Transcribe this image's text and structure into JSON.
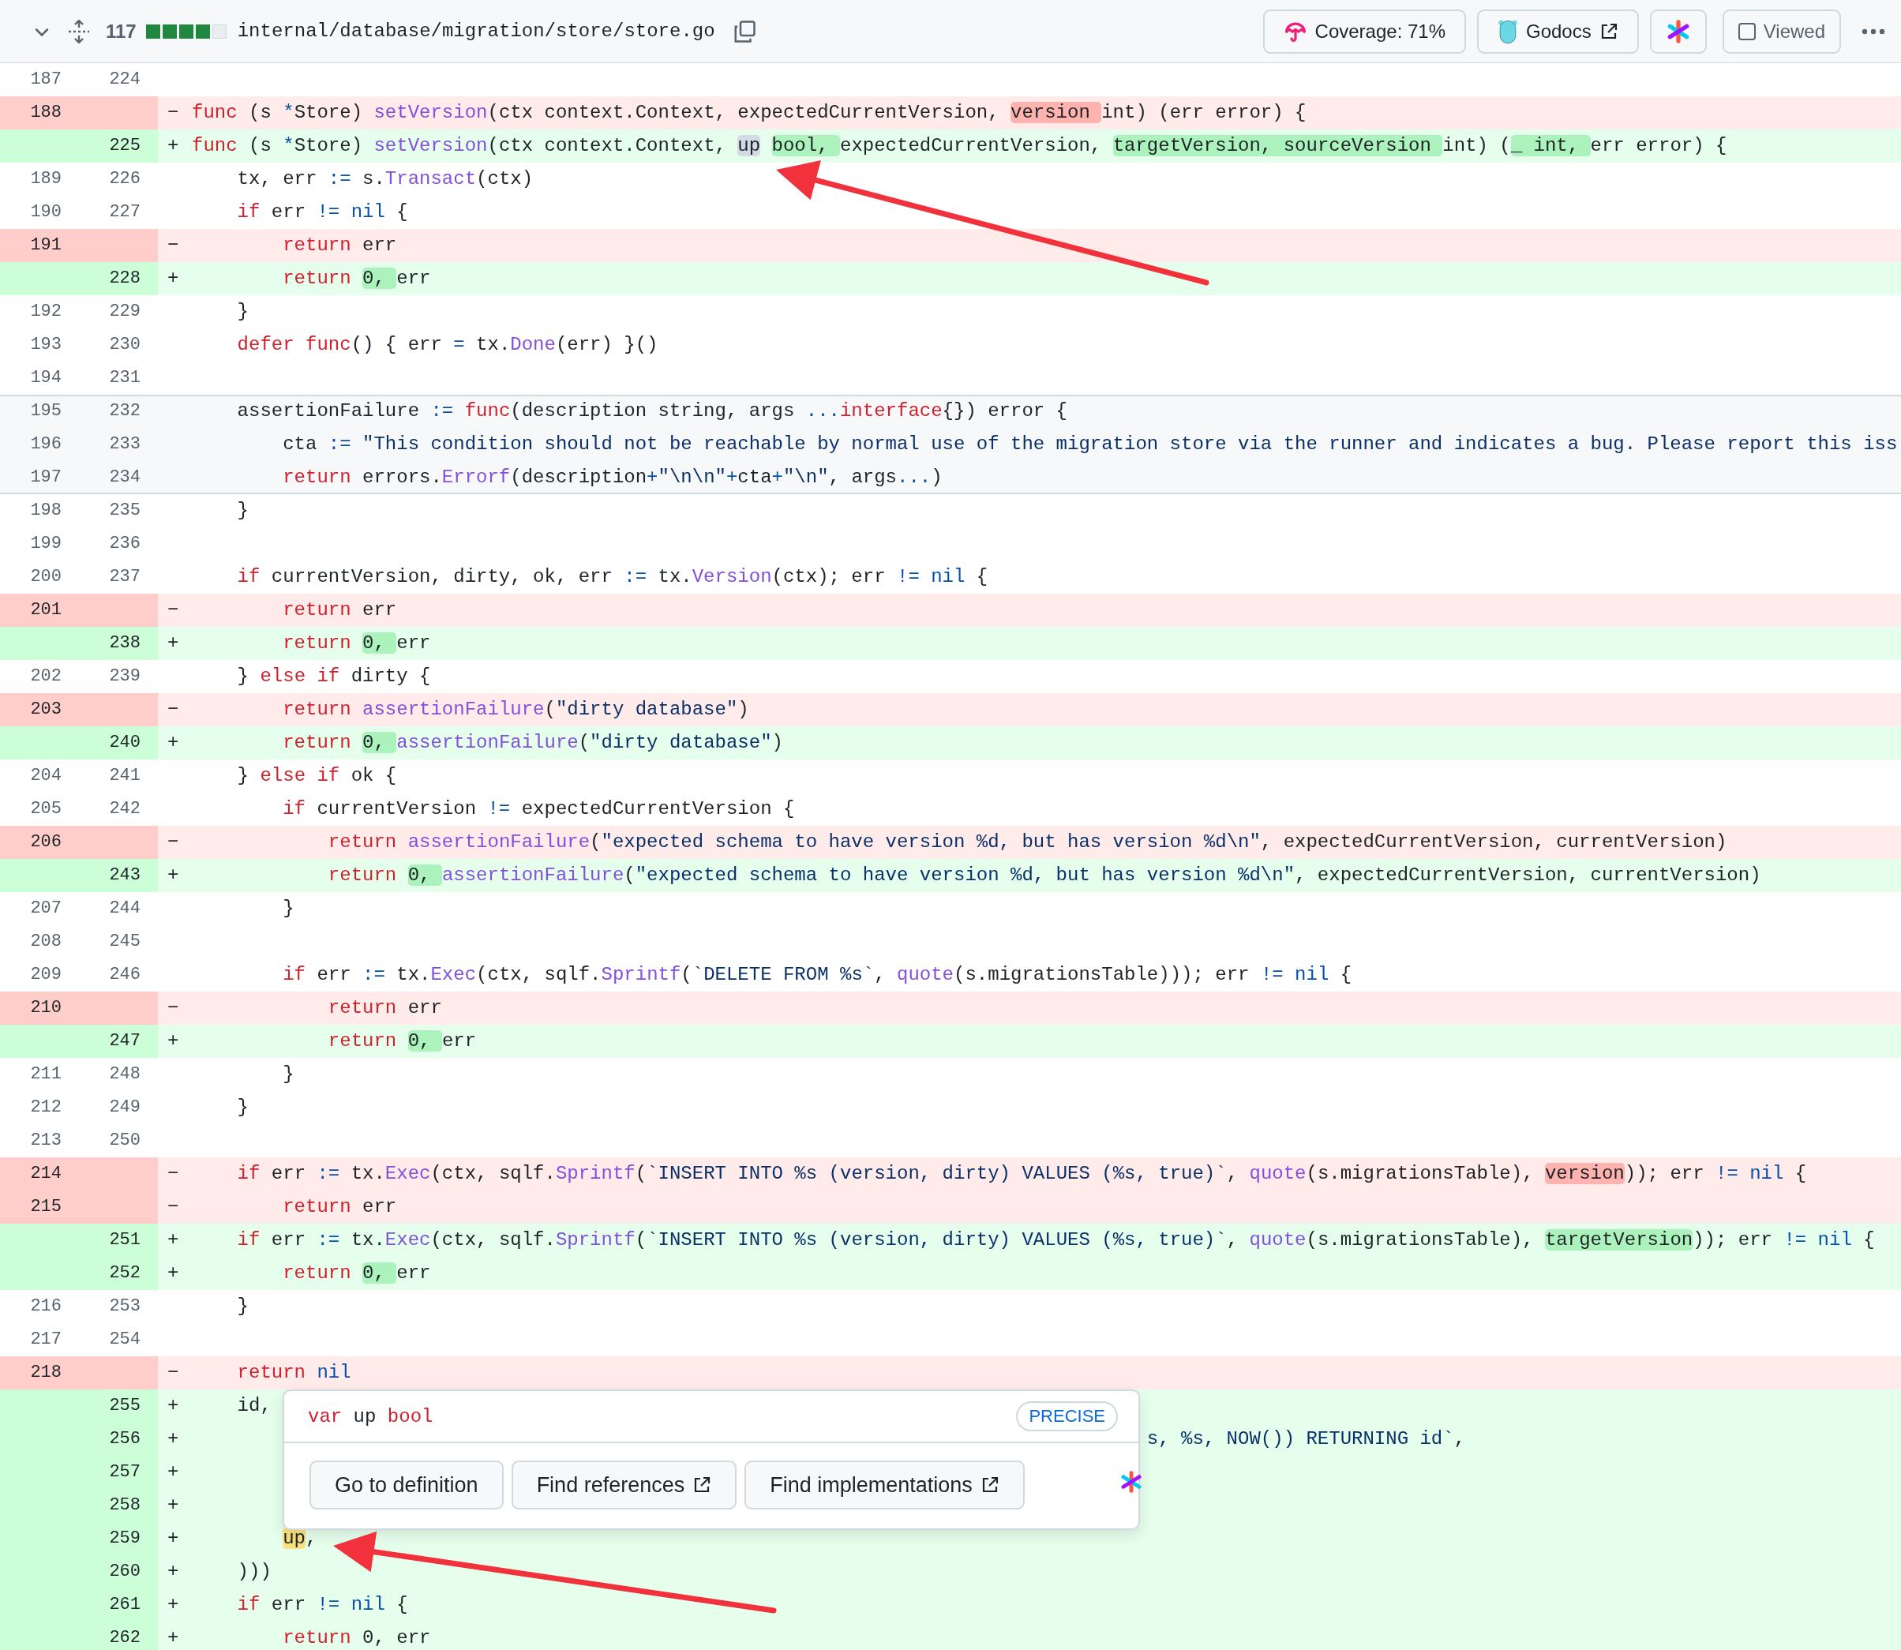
{
  "file_header": {
    "expanded": true,
    "changes": "117",
    "diffstat": [
      {
        "kind": "added"
      },
      {
        "kind": "added"
      },
      {
        "kind": "added"
      },
      {
        "kind": "added"
      },
      {
        "kind": "neutral"
      }
    ],
    "path": "internal/database/migration/store/store.go",
    "buttons": [
      {
        "kind": "coverage",
        "label": "Coverage: 71%"
      },
      {
        "kind": "godocs",
        "label": "Godocs",
        "external": true
      },
      {
        "kind": "extension"
      }
    ],
    "viewed": {
      "label": "Viewed",
      "checked": false
    }
  },
  "lines": [
    {
      "kind": "context",
      "old": "187",
      "new": "224"
    },
    {
      "kind": "deleted",
      "old": "188",
      "sign": "−",
      "code": [
        {
          "text": "func",
          "kind": "keyword"
        },
        {
          "text": " (s ",
          "kind": "plain"
        },
        {
          "text": "*",
          "kind": "operator"
        },
        {
          "text": "Store) ",
          "kind": "plain"
        },
        {
          "text": "setVersion",
          "kind": "function"
        },
        {
          "text": "(ctx context.Context, expectedCurrentVersion, ",
          "kind": "plain"
        },
        {
          "text": "version ",
          "kind": "plain",
          "changed": true
        },
        {
          "text": "int) (err error) {",
          "kind": "plain"
        }
      ]
    },
    {
      "kind": "added",
      "new": "225",
      "sign": "+",
      "code": [
        {
          "text": "func",
          "kind": "keyword"
        },
        {
          "text": " (s ",
          "kind": "plain"
        },
        {
          "text": "*",
          "kind": "operator"
        },
        {
          "text": "Store) ",
          "kind": "plain"
        },
        {
          "text": "setVersion",
          "kind": "function"
        },
        {
          "text": "(ctx context.Context, ",
          "kind": "plain"
        },
        {
          "text": "up",
          "kind": "reference"
        },
        {
          "text": " bool, ",
          "kind": "plain",
          "changed": true
        },
        {
          "text": "expectedCurrentVersion, ",
          "kind": "plain"
        },
        {
          "text": "targetVersion, sourceVersion ",
          "kind": "plain",
          "changed": true
        },
        {
          "text": "int) (",
          "kind": "plain"
        },
        {
          "text": "_ int, ",
          "kind": "plain",
          "changed": true
        },
        {
          "text": "err error) {",
          "kind": "plain"
        }
      ]
    },
    {
      "kind": "context",
      "old": "189",
      "new": "226",
      "code": [
        {
          "text": "    tx, err ",
          "kind": "plain"
        },
        {
          "text": ":=",
          "kind": "operator"
        },
        {
          "text": " s.",
          "kind": "plain"
        },
        {
          "text": "Transact",
          "kind": "function"
        },
        {
          "text": "(ctx)",
          "kind": "plain"
        }
      ]
    },
    {
      "kind": "context",
      "old": "190",
      "new": "227",
      "code": [
        {
          "text": "    if",
          "kind": "keyword"
        },
        {
          "text": " err ",
          "kind": "plain"
        },
        {
          "text": "!=",
          "kind": "operator"
        },
        {
          "text": " nil",
          "kind": "constant"
        },
        {
          "text": " {",
          "kind": "plain"
        }
      ]
    },
    {
      "kind": "deleted",
      "old": "191",
      "sign": "−",
      "code": [
        {
          "text": "        return",
          "kind": "keyword"
        },
        {
          "text": " err",
          "kind": "plain"
        }
      ]
    },
    {
      "kind": "added",
      "new": "228",
      "sign": "+",
      "code": [
        {
          "text": "        return ",
          "kind": "keyword"
        },
        {
          "text": "0, ",
          "kind": "plain",
          "changed": true
        },
        {
          "text": "err",
          "kind": "plain"
        }
      ]
    },
    {
      "kind": "context",
      "old": "192",
      "new": "229",
      "code": [
        {
          "text": "    }",
          "kind": "plain"
        }
      ]
    },
    {
      "kind": "context",
      "old": "193",
      "new": "230",
      "code": [
        {
          "text": "    defer",
          "kind": "keyword"
        },
        {
          "text": " func",
          "kind": "keyword"
        },
        {
          "text": "() { err ",
          "kind": "plain"
        },
        {
          "text": "=",
          "kind": "operator"
        },
        {
          "text": " tx.",
          "kind": "plain"
        },
        {
          "text": "Done",
          "kind": "function"
        },
        {
          "text": "(err) }()",
          "kind": "plain"
        }
      ]
    },
    {
      "kind": "context",
      "old": "194",
      "new": "231"
    },
    {
      "kind": "expanded",
      "old": "195",
      "new": "232",
      "code": [
        {
          "text": "    assertionFailure ",
          "kind": "plain"
        },
        {
          "text": ":=",
          "kind": "operator"
        },
        {
          "text": " func",
          "kind": "keyword"
        },
        {
          "text": "(description string, args ",
          "kind": "plain"
        },
        {
          "text": "...",
          "kind": "operator"
        },
        {
          "text": "interface",
          "kind": "keyword"
        },
        {
          "text": "{}) error {",
          "kind": "plain"
        }
      ]
    },
    {
      "kind": "expanded",
      "old": "196",
      "new": "233",
      "code": [
        {
          "text": "        cta ",
          "kind": "plain"
        },
        {
          "text": ":=",
          "kind": "operator"
        },
        {
          "text": " \"This condition should not be reachable by normal use of the migration store via the runner and indicates a bug. Please report this iss",
          "kind": "string"
        }
      ]
    },
    {
      "kind": "expanded",
      "old": "197",
      "new": "234",
      "code": [
        {
          "text": "        return",
          "kind": "keyword"
        },
        {
          "text": " errors.",
          "kind": "plain"
        },
        {
          "text": "Errorf",
          "kind": "function"
        },
        {
          "text": "(description",
          "kind": "plain"
        },
        {
          "text": "+",
          "kind": "operator"
        },
        {
          "text": "\"\\n\\n\"",
          "kind": "string"
        },
        {
          "text": "+",
          "kind": "operator"
        },
        {
          "text": "cta",
          "kind": "plain"
        },
        {
          "text": "+",
          "kind": "operator"
        },
        {
          "text": "\"\\n\"",
          "kind": "string"
        },
        {
          "text": ", args",
          "kind": "plain"
        },
        {
          "text": "...",
          "kind": "operator"
        },
        {
          "text": ")",
          "kind": "plain"
        }
      ]
    },
    {
      "kind": "context",
      "old": "198",
      "new": "235",
      "code": [
        {
          "text": "    }",
          "kind": "plain"
        }
      ]
    },
    {
      "kind": "context",
      "old": "199",
      "new": "236"
    },
    {
      "kind": "context",
      "old": "200",
      "new": "237",
      "code": [
        {
          "text": "    if",
          "kind": "keyword"
        },
        {
          "text": " currentVersion, dirty, ok, err ",
          "kind": "plain"
        },
        {
          "text": ":=",
          "kind": "operator"
        },
        {
          "text": " tx.",
          "kind": "plain"
        },
        {
          "text": "Version",
          "kind": "function"
        },
        {
          "text": "(ctx); err ",
          "kind": "plain"
        },
        {
          "text": "!=",
          "kind": "operator"
        },
        {
          "text": " nil",
          "kind": "constant"
        },
        {
          "text": " {",
          "kind": "plain"
        }
      ]
    },
    {
      "kind": "deleted",
      "old": "201",
      "sign": "−",
      "code": [
        {
          "text": "        return",
          "kind": "keyword"
        },
        {
          "text": " err",
          "kind": "plain"
        }
      ]
    },
    {
      "kind": "added",
      "new": "238",
      "sign": "+",
      "code": [
        {
          "text": "        return ",
          "kind": "keyword"
        },
        {
          "text": "0, ",
          "kind": "plain",
          "changed": true
        },
        {
          "text": "err",
          "kind": "plain"
        }
      ]
    },
    {
      "kind": "context",
      "old": "202",
      "new": "239",
      "code": [
        {
          "text": "    } ",
          "kind": "plain"
        },
        {
          "text": "else",
          "kind": "keyword"
        },
        {
          "text": " if",
          "kind": "keyword"
        },
        {
          "text": " dirty {",
          "kind": "plain"
        }
      ]
    },
    {
      "kind": "deleted",
      "old": "203",
      "sign": "−",
      "code": [
        {
          "text": "        return ",
          "kind": "keyword"
        },
        {
          "text": "assertionFailure",
          "kind": "function"
        },
        {
          "text": "(",
          "kind": "plain"
        },
        {
          "text": "\"dirty database\"",
          "kind": "string"
        },
        {
          "text": ")",
          "kind": "plain"
        }
      ]
    },
    {
      "kind": "added",
      "new": "240",
      "sign": "+",
      "code": [
        {
          "text": "        return ",
          "kind": "keyword"
        },
        {
          "text": "0, ",
          "kind": "plain",
          "changed": true
        },
        {
          "text": "assertionFailure",
          "kind": "function"
        },
        {
          "text": "(",
          "kind": "plain"
        },
        {
          "text": "\"dirty database\"",
          "kind": "string"
        },
        {
          "text": ")",
          "kind": "plain"
        }
      ]
    },
    {
      "kind": "context",
      "old": "204",
      "new": "241",
      "code": [
        {
          "text": "    } ",
          "kind": "plain"
        },
        {
          "text": "else",
          "kind": "keyword"
        },
        {
          "text": " if",
          "kind": "keyword"
        },
        {
          "text": " ok {",
          "kind": "plain"
        }
      ]
    },
    {
      "kind": "context",
      "old": "205",
      "new": "242",
      "code": [
        {
          "text": "        if",
          "kind": "keyword"
        },
        {
          "text": " currentVersion ",
          "kind": "plain"
        },
        {
          "text": "!=",
          "kind": "operator"
        },
        {
          "text": " expectedCurrentVersion {",
          "kind": "plain"
        }
      ]
    },
    {
      "kind": "deleted",
      "old": "206",
      "sign": "−",
      "code": [
        {
          "text": "            return ",
          "kind": "keyword"
        },
        {
          "text": "assertionFailure",
          "kind": "function"
        },
        {
          "text": "(",
          "kind": "plain"
        },
        {
          "text": "\"expected schema to have version %d, but has version %d\\n\"",
          "kind": "string"
        },
        {
          "text": ", expectedCurrentVersion, currentVersion)",
          "kind": "plain"
        }
      ]
    },
    {
      "kind": "added",
      "new": "243",
      "sign": "+",
      "code": [
        {
          "text": "            return ",
          "kind": "keyword"
        },
        {
          "text": "0, ",
          "kind": "plain",
          "changed": true
        },
        {
          "text": "assertionFailure",
          "kind": "function"
        },
        {
          "text": "(",
          "kind": "plain"
        },
        {
          "text": "\"expected schema to have version %d, but has version %d\\n\"",
          "kind": "string"
        },
        {
          "text": ", expectedCurrentVersion, currentVersion)",
          "kind": "plain"
        }
      ]
    },
    {
      "kind": "context",
      "old": "207",
      "new": "244",
      "code": [
        {
          "text": "        }",
          "kind": "plain"
        }
      ]
    },
    {
      "kind": "context",
      "old": "208",
      "new": "245"
    },
    {
      "kind": "context",
      "old": "209",
      "new": "246",
      "code": [
        {
          "text": "        if",
          "kind": "keyword"
        },
        {
          "text": " err ",
          "kind": "plain"
        },
        {
          "text": ":=",
          "kind": "operator"
        },
        {
          "text": " tx.",
          "kind": "plain"
        },
        {
          "text": "Exec",
          "kind": "function"
        },
        {
          "text": "(ctx, sqlf.",
          "kind": "plain"
        },
        {
          "text": "Sprintf",
          "kind": "function"
        },
        {
          "text": "(",
          "kind": "plain"
        },
        {
          "text": "`DELETE FROM %s`",
          "kind": "string"
        },
        {
          "text": ", ",
          "kind": "plain"
        },
        {
          "text": "quote",
          "kind": "function"
        },
        {
          "text": "(s.migrationsTable))); err ",
          "kind": "plain"
        },
        {
          "text": "!=",
          "kind": "operator"
        },
        {
          "text": " nil",
          "kind": "constant"
        },
        {
          "text": " {",
          "kind": "plain"
        }
      ]
    },
    {
      "kind": "deleted",
      "old": "210",
      "sign": "−",
      "code": [
        {
          "text": "            return",
          "kind": "keyword"
        },
        {
          "text": " err",
          "kind": "plain"
        }
      ]
    },
    {
      "kind": "added",
      "new": "247",
      "sign": "+",
      "code": [
        {
          "text": "            return ",
          "kind": "keyword"
        },
        {
          "text": "0, ",
          "kind": "plain",
          "changed": true
        },
        {
          "text": "err",
          "kind": "plain"
        }
      ]
    },
    {
      "kind": "context",
      "old": "211",
      "new": "248",
      "code": [
        {
          "text": "        }",
          "kind": "plain"
        }
      ]
    },
    {
      "kind": "context",
      "old": "212",
      "new": "249",
      "code": [
        {
          "text": "    }",
          "kind": "plain"
        }
      ]
    },
    {
      "kind": "context",
      "old": "213",
      "new": "250"
    },
    {
      "kind": "deleted",
      "old": "214",
      "sign": "−",
      "code": [
        {
          "text": "    if",
          "kind": "keyword"
        },
        {
          "text": " err ",
          "kind": "plain"
        },
        {
          "text": ":=",
          "kind": "operator"
        },
        {
          "text": " tx.",
          "kind": "plain"
        },
        {
          "text": "Exec",
          "kind": "function"
        },
        {
          "text": "(ctx, sqlf.",
          "kind": "plain"
        },
        {
          "text": "Sprintf",
          "kind": "function"
        },
        {
          "text": "(",
          "kind": "plain"
        },
        {
          "text": "`INSERT INTO %s (version, dirty) VALUES (%s, true)`",
          "kind": "string"
        },
        {
          "text": ", ",
          "kind": "plain"
        },
        {
          "text": "quote",
          "kind": "function"
        },
        {
          "text": "(s.migrationsTable), ",
          "kind": "plain"
        },
        {
          "text": "version",
          "kind": "plain",
          "changed": true
        },
        {
          "text": ")); err ",
          "kind": "plain"
        },
        {
          "text": "!=",
          "kind": "operator"
        },
        {
          "text": " nil",
          "kind": "constant"
        },
        {
          "text": " {",
          "kind": "plain"
        }
      ]
    },
    {
      "kind": "deleted",
      "old": "215",
      "sign": "−",
      "code": [
        {
          "text": "        return",
          "kind": "keyword"
        },
        {
          "text": " err",
          "kind": "plain"
        }
      ]
    },
    {
      "kind": "added",
      "new": "251",
      "sign": "+",
      "code": [
        {
          "text": "    if",
          "kind": "keyword"
        },
        {
          "text": " err ",
          "kind": "plain"
        },
        {
          "text": ":=",
          "kind": "operator"
        },
        {
          "text": " tx.",
          "kind": "plain"
        },
        {
          "text": "Exec",
          "kind": "function"
        },
        {
          "text": "(ctx, sqlf.",
          "kind": "plain"
        },
        {
          "text": "Sprintf",
          "kind": "function"
        },
        {
          "text": "(",
          "kind": "plain"
        },
        {
          "text": "`INSERT INTO %s (version, dirty) VALUES (%s, true)`",
          "kind": "string"
        },
        {
          "text": ", ",
          "kind": "plain"
        },
        {
          "text": "quote",
          "kind": "function"
        },
        {
          "text": "(s.migrationsTable), ",
          "kind": "plain"
        },
        {
          "text": "targetVersion",
          "kind": "plain",
          "changed": true
        },
        {
          "text": ")); err ",
          "kind": "plain"
        },
        {
          "text": "!=",
          "kind": "operator"
        },
        {
          "text": " nil",
          "kind": "constant"
        },
        {
          "text": " {",
          "kind": "plain"
        }
      ]
    },
    {
      "kind": "added",
      "new": "252",
      "sign": "+",
      "code": [
        {
          "text": "        return ",
          "kind": "keyword"
        },
        {
          "text": "0, ",
          "kind": "plain",
          "changed": true
        },
        {
          "text": "err",
          "kind": "plain"
        }
      ]
    },
    {
      "kind": "context",
      "old": "216",
      "new": "253",
      "code": [
        {
          "text": "    }",
          "kind": "plain"
        }
      ]
    },
    {
      "kind": "context",
      "old": "217",
      "new": "254"
    },
    {
      "kind": "deleted",
      "old": "218",
      "sign": "−",
      "code": [
        {
          "text": "    return",
          "kind": "keyword"
        },
        {
          "text": " nil",
          "kind": "constant"
        }
      ]
    },
    {
      "kind": "added",
      "new": "255",
      "sign": "+",
      "code": [
        {
          "text": "    id,",
          "kind": "plain"
        }
      ]
    },
    {
      "kind": "added",
      "new": "256",
      "sign": "+",
      "code": [
        {
          "text": "                                                                                    s, %s, NOW()) RETURNING id`",
          "kind": "string"
        },
        {
          "text": ",",
          "kind": "plain"
        }
      ]
    },
    {
      "kind": "added",
      "new": "257",
      "sign": "+"
    },
    {
      "kind": "added",
      "new": "258",
      "sign": "+"
    },
    {
      "kind": "added",
      "new": "259",
      "sign": "+",
      "code": [
        {
          "text": "        up",
          "kind": "hover"
        },
        {
          "text": ",",
          "kind": "plain"
        }
      ]
    },
    {
      "kind": "added",
      "new": "260",
      "sign": "+",
      "code": [
        {
          "text": "    )))",
          "kind": "plain"
        }
      ]
    },
    {
      "kind": "added",
      "new": "261",
      "sign": "+",
      "code": [
        {
          "text": "    if",
          "kind": "keyword"
        },
        {
          "text": " err ",
          "kind": "plain"
        },
        {
          "text": "!=",
          "kind": "operator"
        },
        {
          "text": " nil",
          "kind": "constant"
        },
        {
          "text": " {",
          "kind": "plain"
        }
      ]
    },
    {
      "kind": "added",
      "new": "262",
      "sign": "+",
      "code": [
        {
          "text": "        return",
          "kind": "keyword"
        },
        {
          "text": " 0, err",
          "kind": "plain"
        }
      ]
    }
  ],
  "hover_card": {
    "signature": [
      {
        "text": "var",
        "kind": "keyword"
      },
      {
        "text": " up ",
        "kind": "plain"
      },
      {
        "text": "bool",
        "kind": "keyword"
      }
    ],
    "badge": "PRECISE",
    "actions": [
      {
        "label": "Go to definition",
        "external": false
      },
      {
        "label": "Find references",
        "external": true
      },
      {
        "label": "Find implementations",
        "external": true
      }
    ]
  }
}
